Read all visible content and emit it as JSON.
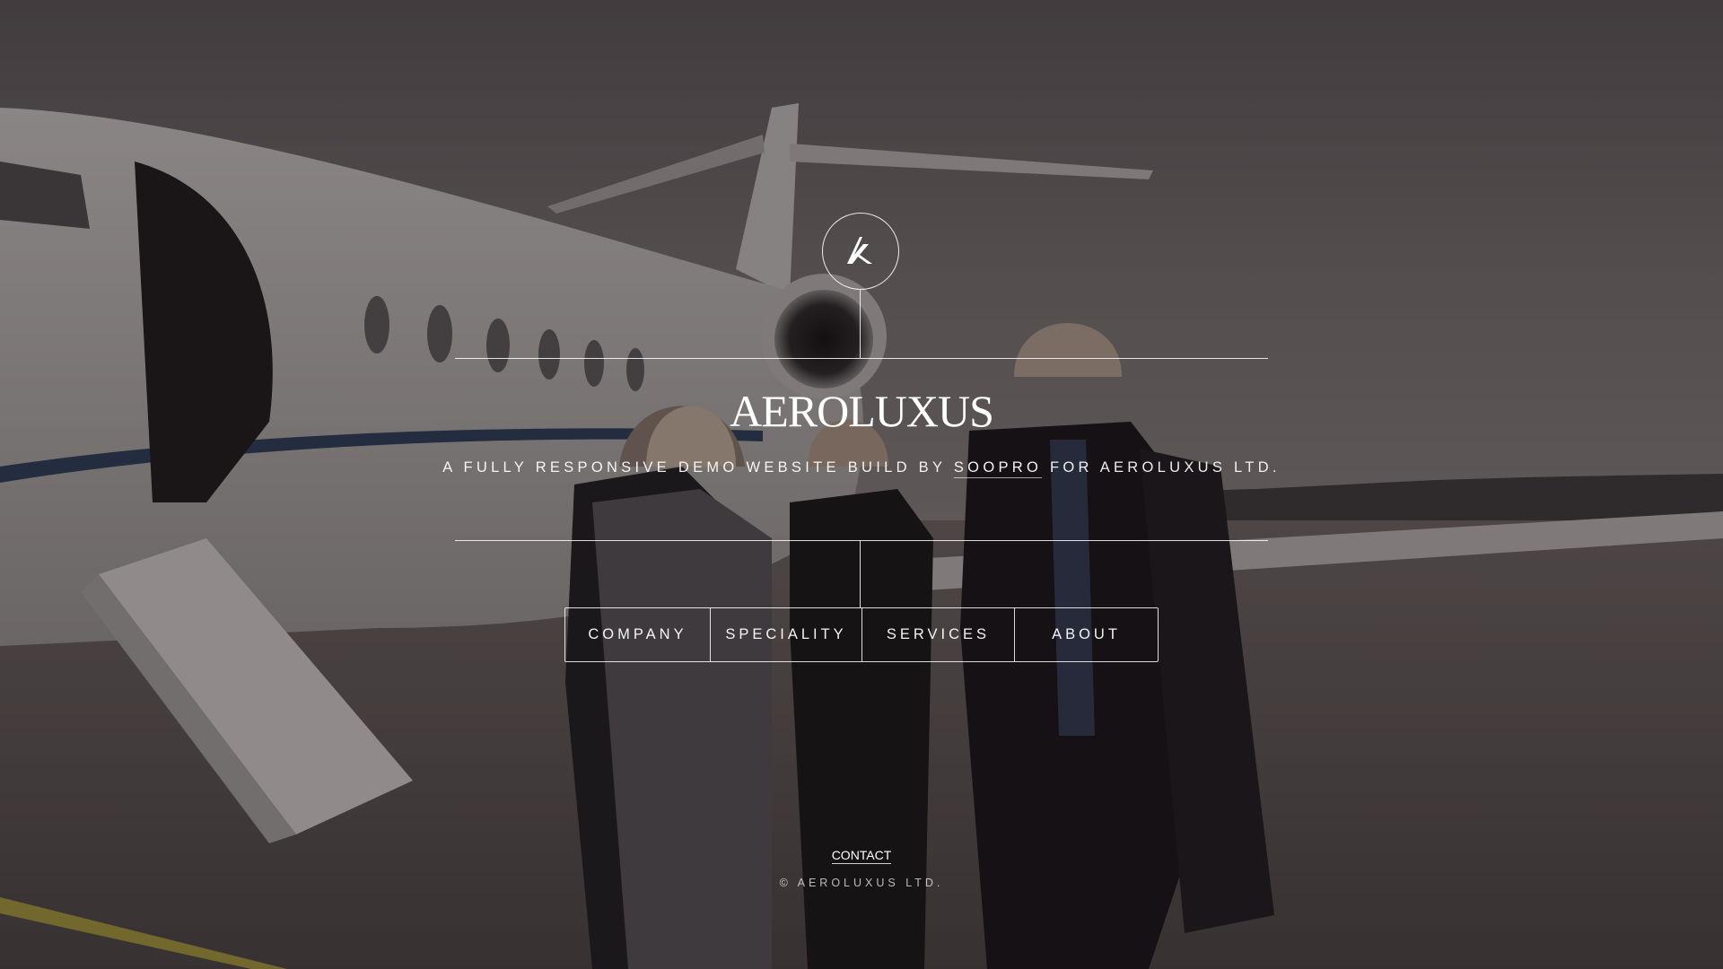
{
  "brand": {
    "name": "AEROLUXUS",
    "logo_icon": "aeroluxus-monogram-icon"
  },
  "tagline": {
    "before_link": "A FULLY RESPONSIVE DEMO WEBSITE BUILD BY ",
    "link_text": "SOOPRO",
    "after_link": " FOR AEROLUXUS LTD."
  },
  "nav": {
    "items": [
      {
        "label": "COMPANY"
      },
      {
        "label": "SPECIALITY"
      },
      {
        "label": "SERVICES"
      },
      {
        "label": "ABOUT"
      }
    ]
  },
  "footer": {
    "contact_label": "CONTACT",
    "copyright": "© AEROLUXUS LTD."
  },
  "background": {
    "description_icon": "private-jet-crew-photo",
    "overlay_color": "#1e1b1d"
  }
}
